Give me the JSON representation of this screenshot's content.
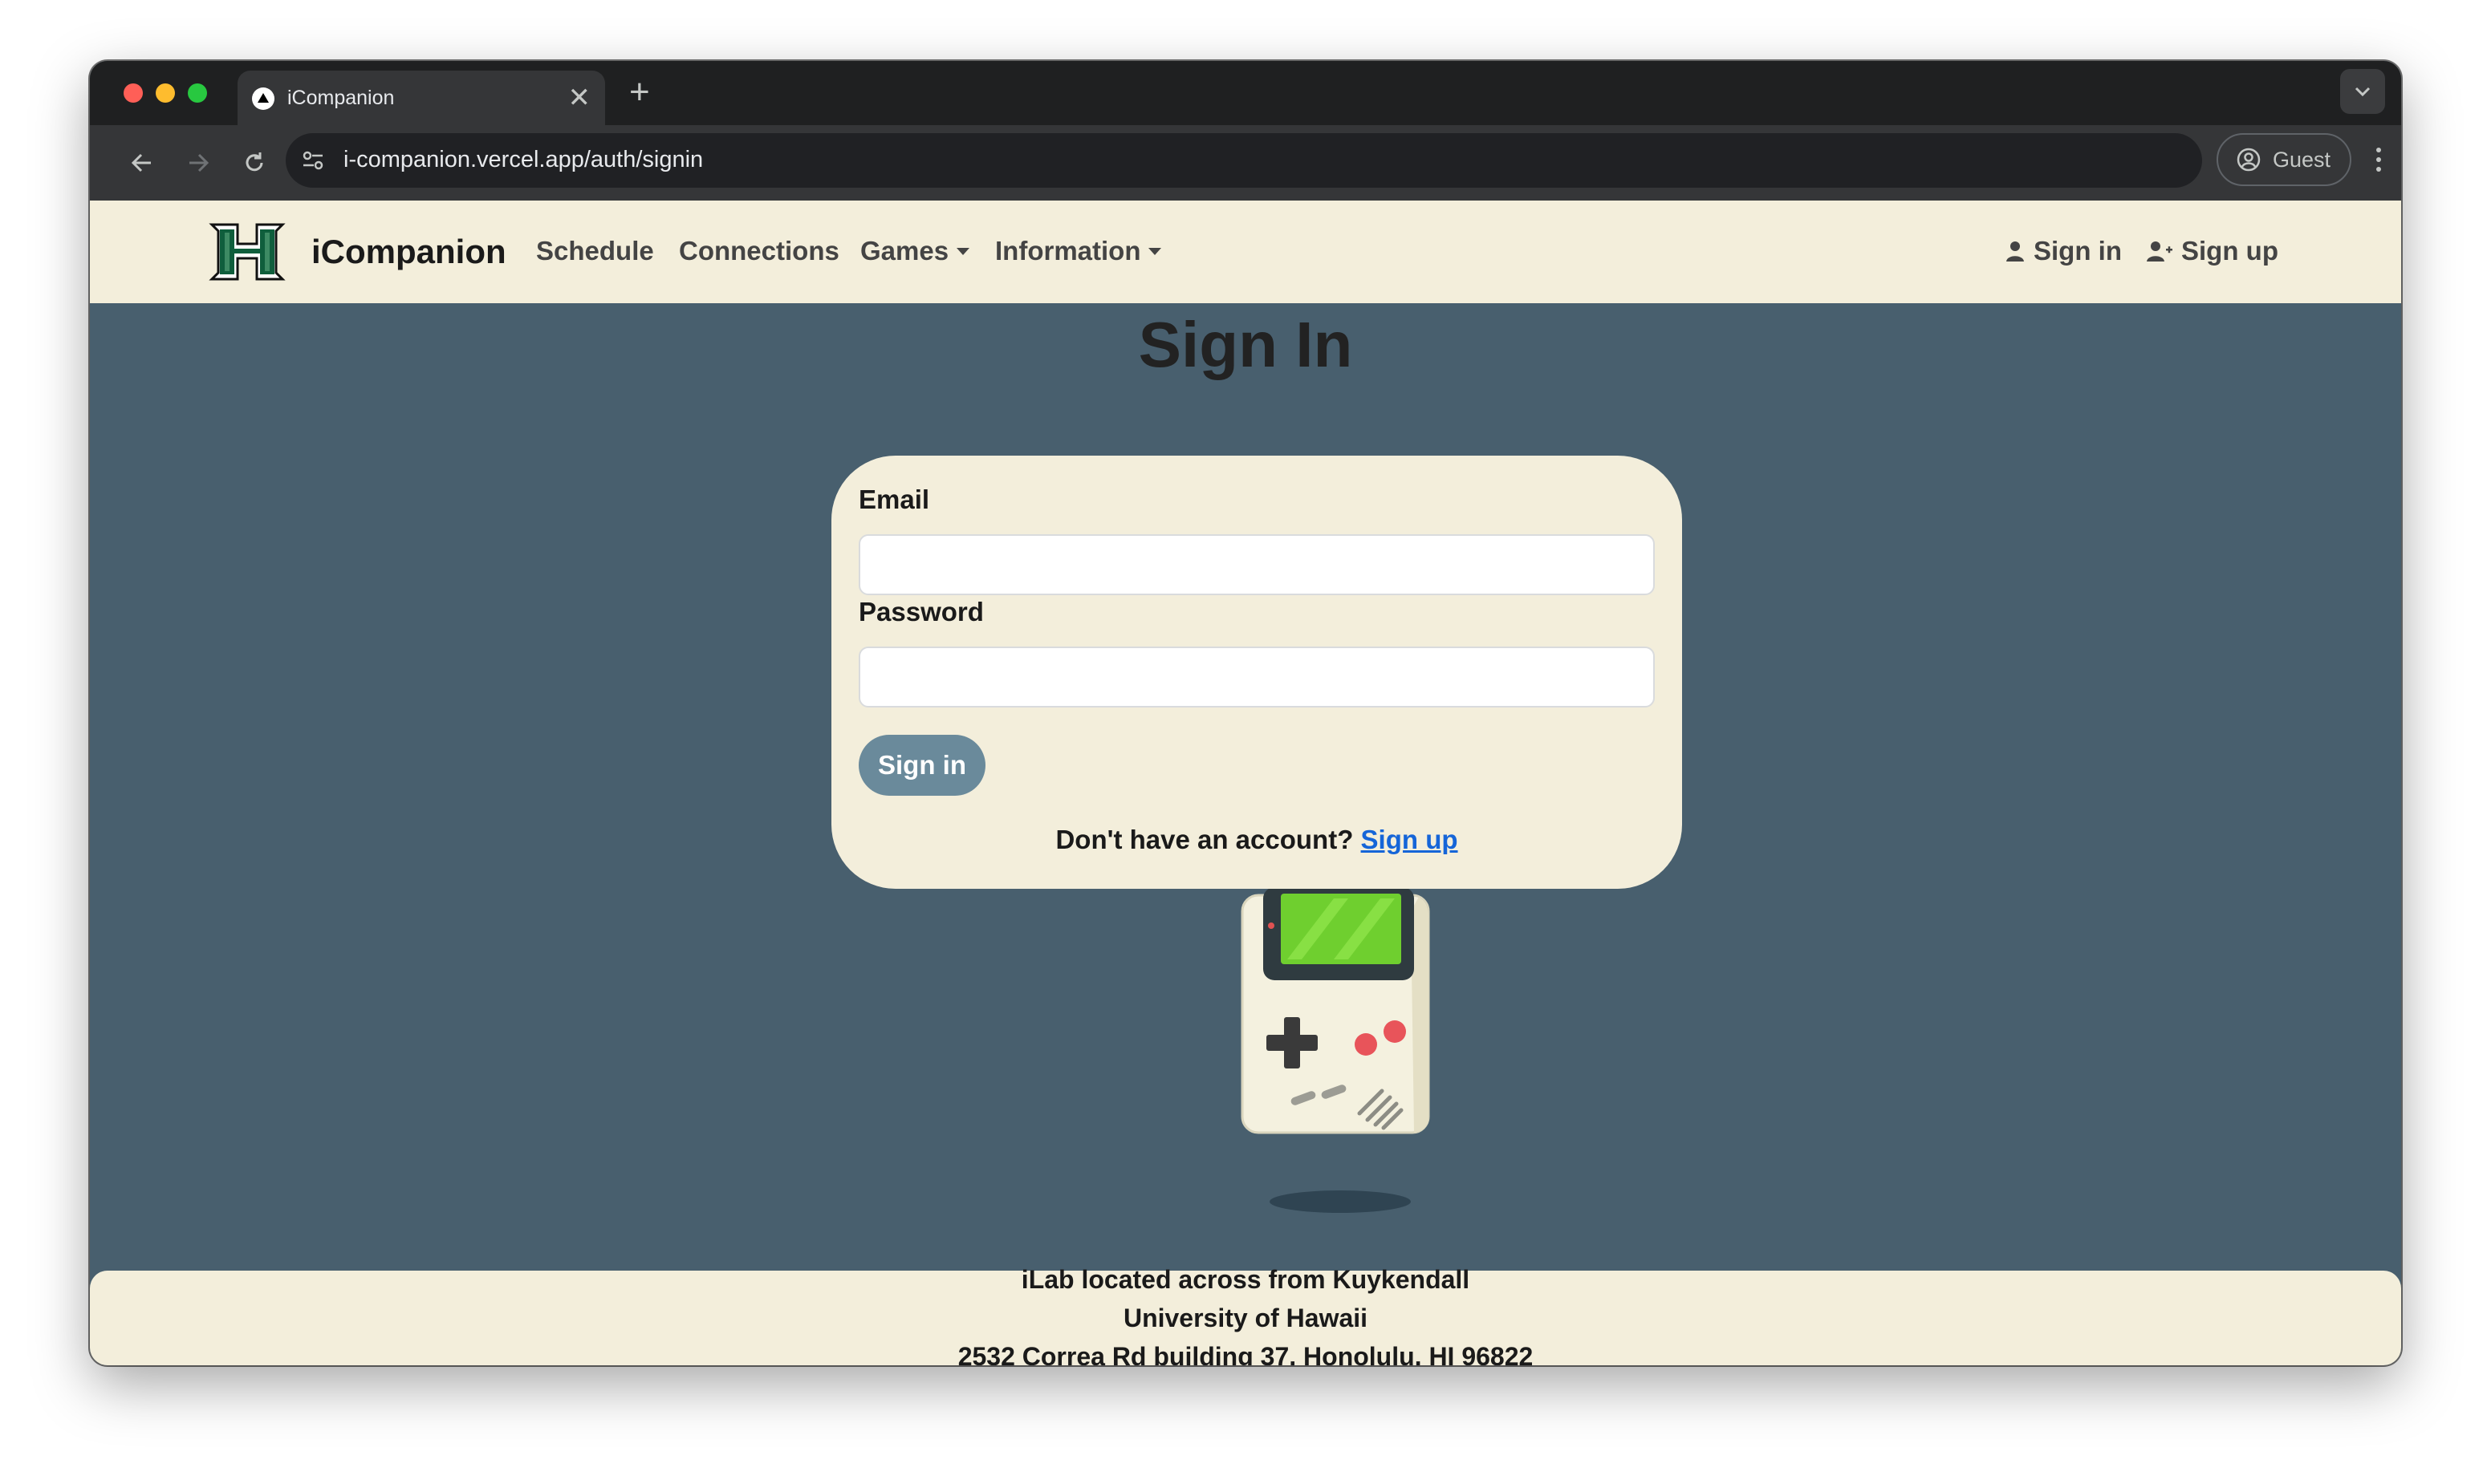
{
  "browser": {
    "tab_title": "iCompanion",
    "tab_close_glyph": "✕",
    "new_tab_glyph": "+",
    "url": "i-companion.vercel.app/auth/signin",
    "profile_label": "Guest"
  },
  "navbar": {
    "brand": "iCompanion",
    "links": [
      "Schedule",
      "Connections",
      "Games",
      "Information"
    ],
    "sign_in": "Sign in",
    "sign_up": "Sign up"
  },
  "signin": {
    "title": "Sign In",
    "email_label": "Email",
    "email_value": "",
    "password_label": "Password",
    "password_value": "",
    "submit_label": "Sign in",
    "no_account_text": "Don't have an account?",
    "signup_link": "Sign up"
  },
  "footer": {
    "lines": [
      "iLab located across from Kuykendall",
      "University of Hawaii",
      "2532 Correa Rd building 37, Honolulu, HI 96822"
    ]
  },
  "colors": {
    "page_bg": "#485f6e",
    "panel_bg": "#f3eedb",
    "button_bg": "#6a8a9b",
    "link": "#1565d8",
    "logo_green": "#0f5e3c"
  },
  "icons": [
    "back-arrow-icon",
    "forward-arrow-icon",
    "reload-icon",
    "site-info-icon",
    "profile-icon",
    "kebab-menu-icon",
    "person-icon",
    "person-add-icon",
    "hawaii-h-logo",
    "gameboy-illustration"
  ]
}
